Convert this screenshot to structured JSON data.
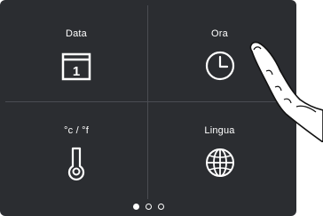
{
  "tiles": [
    {
      "label": "Data",
      "icon": "calendar-icon",
      "day": "1"
    },
    {
      "label": "Ora",
      "icon": "clock-icon"
    },
    {
      "label": "°c / °f",
      "icon": "thermometer-icon"
    },
    {
      "label": "Lingua",
      "icon": "globe-icon"
    }
  ],
  "pagination": {
    "pages": 3,
    "current": 1
  },
  "colors": {
    "background": "#2b2d31",
    "foreground": "#ffffff",
    "divider": "#4a4c52"
  }
}
